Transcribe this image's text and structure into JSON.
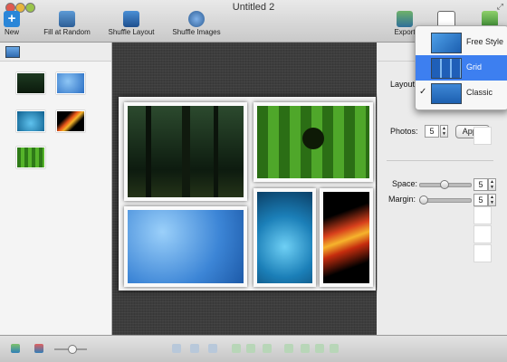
{
  "window": {
    "title": "Untitled 2"
  },
  "toolbar": {
    "new_label": "New",
    "fill_label": "Fill at Random",
    "shuffle_layout_label": "Shuffle Layout",
    "shuffle_images_label": "Shuffle Images",
    "export_label": "Export"
  },
  "panel": {
    "layout_label": "Layout",
    "photos_label": "Photos:",
    "photos_value": "5",
    "apply_label": "Apply",
    "space_label": "Space:",
    "space_value": "5",
    "margin_label": "Margin:",
    "margin_value": "5"
  },
  "layout_menu": {
    "items": [
      {
        "label": "Free Style",
        "selected": false,
        "checked": false
      },
      {
        "label": "Grid",
        "selected": true,
        "checked": false
      },
      {
        "label": "Classic",
        "selected": false,
        "checked": true
      }
    ]
  },
  "colors": {
    "menu_highlight": "#3d7ff0",
    "canvas_bg": "#3d3d3d"
  },
  "icons": [
    "plus-icon",
    "fill-icon",
    "shuffle-layout-icon",
    "shuffle-images-icon",
    "export-icon",
    "mail-icon",
    "upload-icon",
    "image-icon",
    "layout-icon"
  ]
}
